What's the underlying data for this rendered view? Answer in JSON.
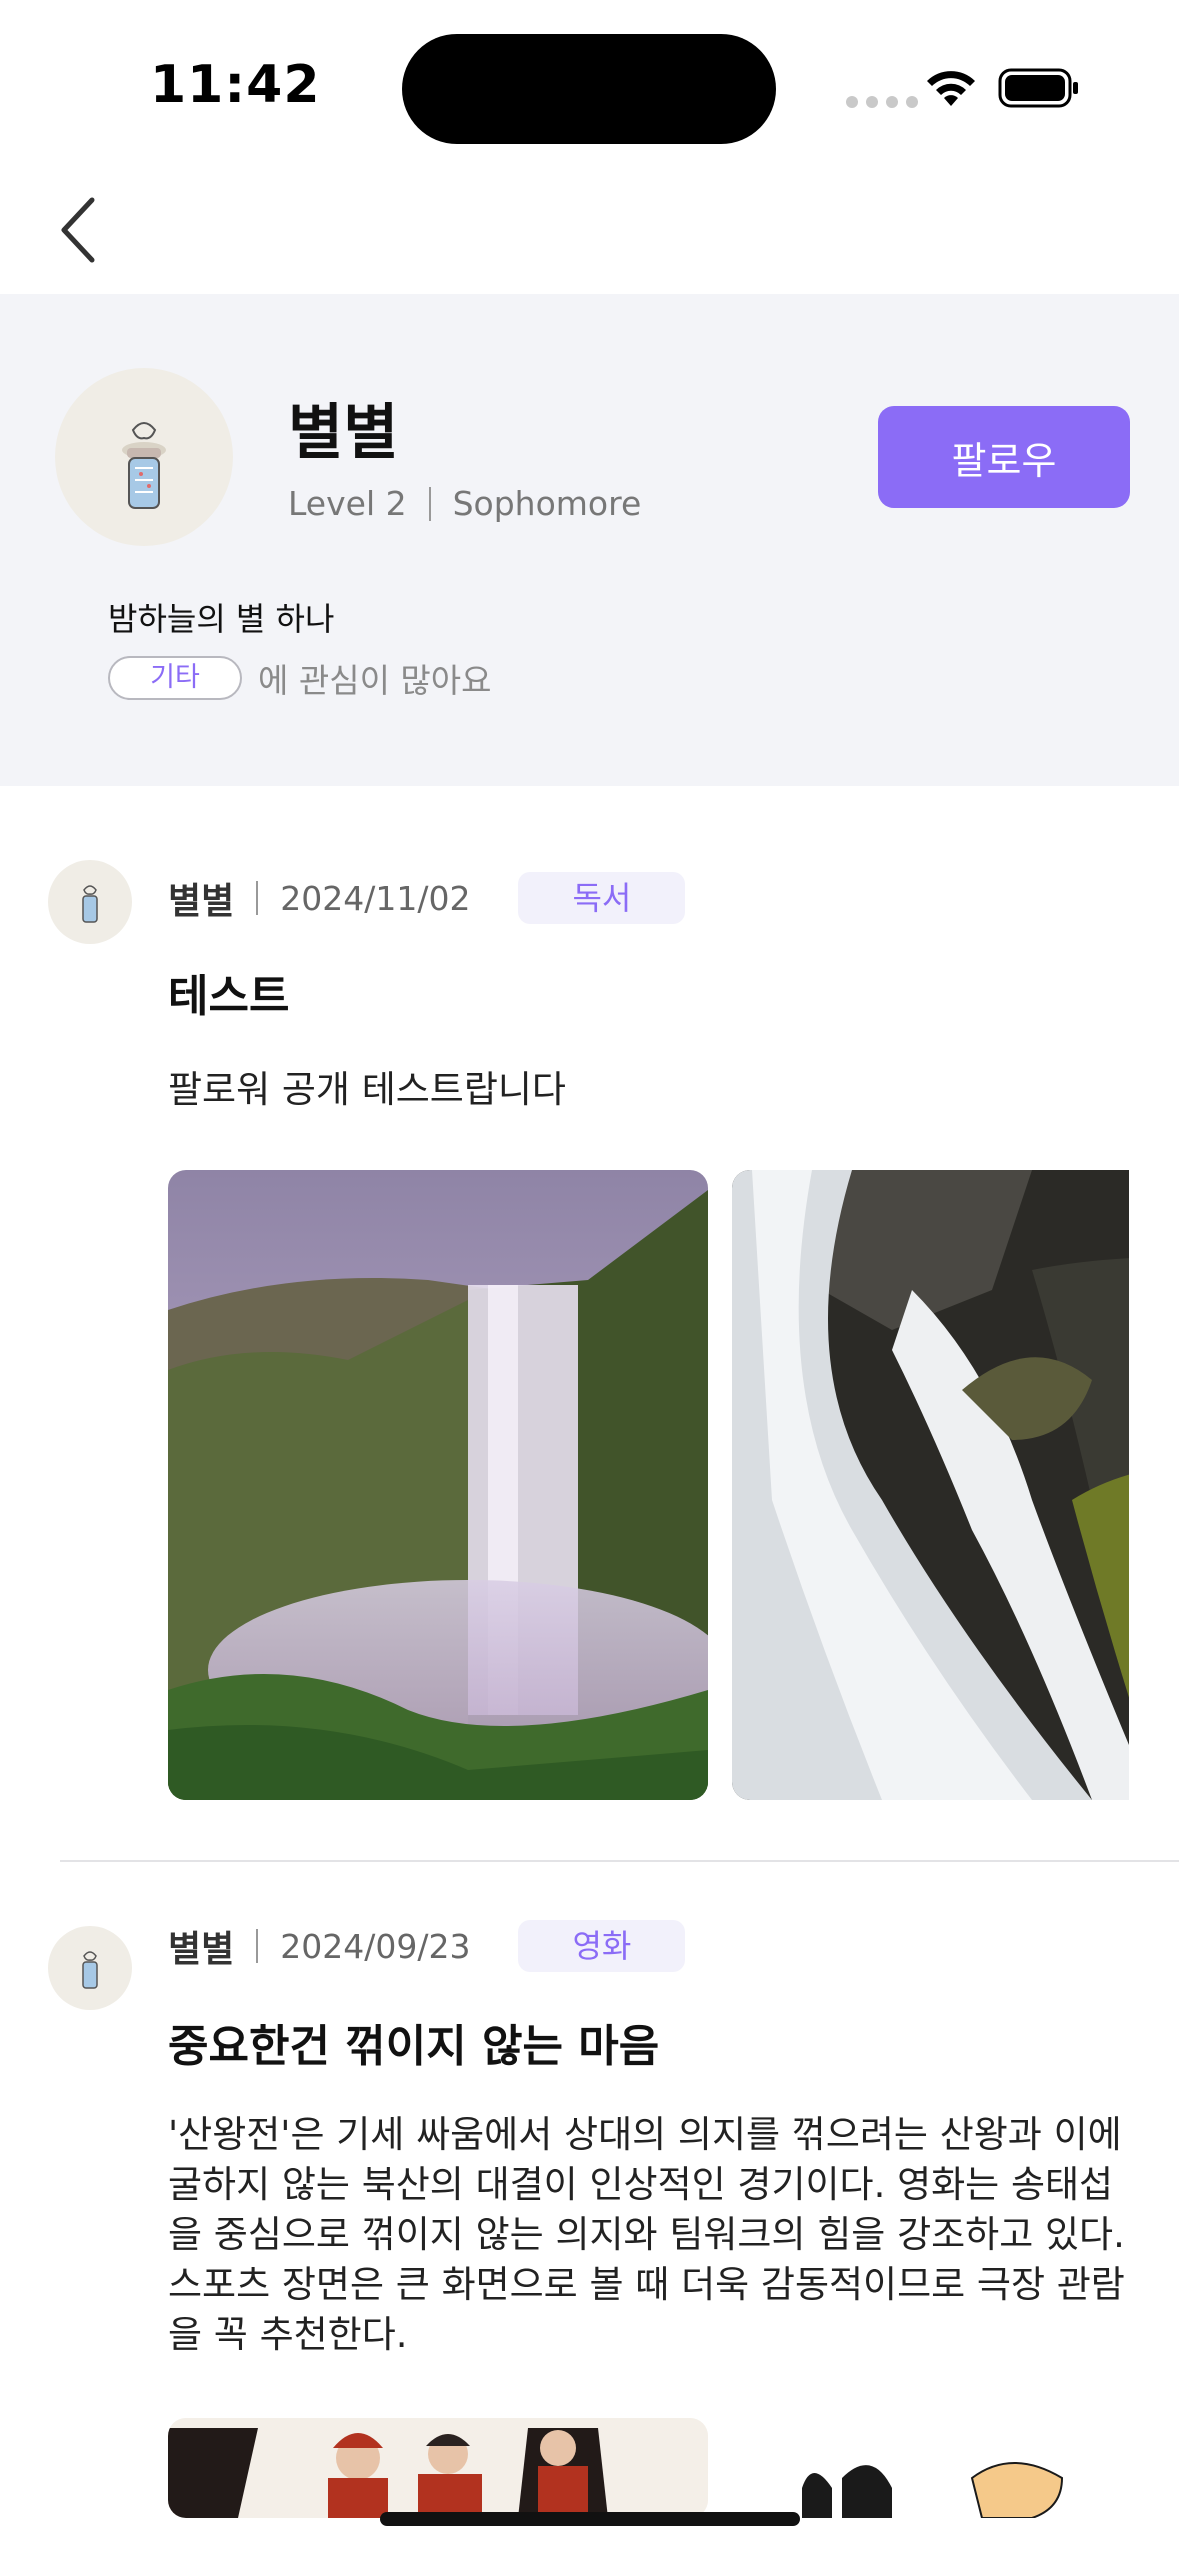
{
  "status_bar": {
    "time": "11:42"
  },
  "profile": {
    "name": "별별",
    "level": "Level 2",
    "grade": "Sophomore",
    "follow_label": "팔로우",
    "bio": "밤하늘의 별 하나",
    "interest_tag": "기타",
    "interest_suffix": "에 관심이 많아요"
  },
  "posts": [
    {
      "author": "별별",
      "date": "2024/11/02",
      "category": "독서",
      "title": "테스트",
      "body": "팔로워 공개 테스트랍니다"
    },
    {
      "author": "별별",
      "date": "2024/09/23",
      "category": "영화",
      "title": "중요한건 꺾이지 않는 마음",
      "body": "'산왕전'은 기세 싸움에서 상대의 의지를 꺾으려는 산왕과 이에 굴하지 않는 북산의 대결이 인상적인 경기이다. 영화는 송태섭을 중심으로 꺾이지 않는 의지와 팀워크의 힘을 강조하고 있다. 스포츠 장면은 큰 화면으로 볼 때 더욱 감동적이므로 극장 관람을 꼭 추천한다."
    }
  ],
  "colors": {
    "accent": "#8b6cf6",
    "header_bg": "#f3f4f8",
    "tag_bg": "#f2f1fb"
  },
  "icons": [
    "back-chevron-icon",
    "wifi-icon",
    "battery-icon",
    "cellular-signal-icon"
  ]
}
